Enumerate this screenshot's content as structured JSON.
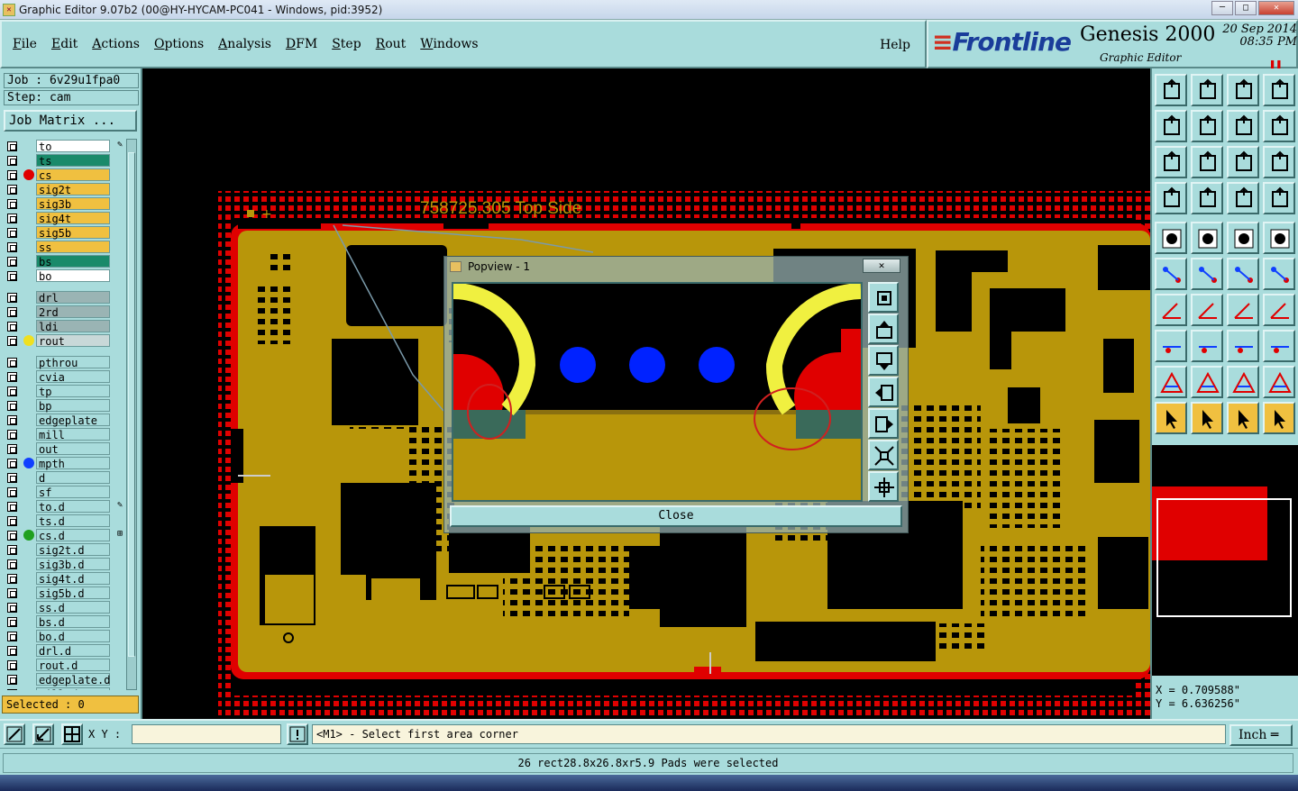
{
  "window": {
    "title": "Graphic Editor 9.07b2 (00@HY-HYCAM-PC041 - Windows, pid:3952)",
    "buttons": {
      "minimize": "─",
      "maximize": "□",
      "close": "✕"
    }
  },
  "menu": {
    "items": [
      "File",
      "Edit",
      "Actions",
      "Options",
      "Analysis",
      "DFM",
      "Step",
      "Rout",
      "Windows"
    ],
    "help": "Help"
  },
  "branding": {
    "logo": "Frontline",
    "product": "Genesis 2000",
    "subtitle": "Graphic Editor",
    "date": "20 Sep 2014",
    "time": "08:35 PM"
  },
  "job": {
    "job_label": "Job : 6v29u1fpa0",
    "step_label": "Step: cam",
    "matrix_button": "Job Matrix ..."
  },
  "layers": {
    "group1": [
      {
        "name": "to",
        "bg": "#ffffff",
        "dot": "",
        "edit": "✎"
      },
      {
        "name": "ts",
        "bg": "#1a8a6a",
        "dot": "",
        "edit": ""
      },
      {
        "name": "cs",
        "bg": "#f0c040",
        "dot": "#e00000",
        "edit": ""
      },
      {
        "name": "sig2t",
        "bg": "#f0c040",
        "dot": "",
        "edit": ""
      },
      {
        "name": "sig3b",
        "bg": "#f0c040",
        "dot": "",
        "edit": ""
      },
      {
        "name": "sig4t",
        "bg": "#f0c040",
        "dot": "",
        "edit": ""
      },
      {
        "name": "sig5b",
        "bg": "#f0c040",
        "dot": "",
        "edit": ""
      },
      {
        "name": "ss",
        "bg": "#f0c040",
        "dot": "",
        "edit": ""
      },
      {
        "name": "bs",
        "bg": "#1a8a6a",
        "dot": "",
        "edit": ""
      },
      {
        "name": "bo",
        "bg": "#ffffff",
        "dot": "",
        "edit": ""
      }
    ],
    "group2": [
      {
        "name": "drl",
        "bg": "#9ab4b4",
        "dot": "",
        "edit": ""
      },
      {
        "name": "2rd",
        "bg": "#9ab4b4",
        "dot": "",
        "edit": ""
      },
      {
        "name": "ldi",
        "bg": "#9ab4b4",
        "dot": "",
        "edit": ""
      },
      {
        "name": "rout",
        "bg": "#c8d8d8",
        "dot": "#f0e020",
        "edit": ""
      }
    ],
    "group3": [
      {
        "name": "pthrou",
        "bg": "#a9dcdc",
        "dot": "",
        "edit": ""
      },
      {
        "name": "cvia",
        "bg": "#a9dcdc",
        "dot": "",
        "edit": ""
      },
      {
        "name": "tp",
        "bg": "#a9dcdc",
        "dot": "",
        "edit": ""
      },
      {
        "name": "bp",
        "bg": "#a9dcdc",
        "dot": "",
        "edit": ""
      },
      {
        "name": "edgeplate",
        "bg": "#a9dcdc",
        "dot": "",
        "edit": ""
      },
      {
        "name": "mill",
        "bg": "#a9dcdc",
        "dot": "",
        "edit": ""
      },
      {
        "name": "out",
        "bg": "#a9dcdc",
        "dot": "",
        "edit": ""
      },
      {
        "name": "mpth",
        "bg": "#a9dcdc",
        "dot": "#1040ff",
        "edit": ""
      },
      {
        "name": "d",
        "bg": "#a9dcdc",
        "dot": "",
        "edit": ""
      },
      {
        "name": "sf",
        "bg": "#a9dcdc",
        "dot": "",
        "edit": ""
      },
      {
        "name": "to.d",
        "bg": "#a9dcdc",
        "dot": "",
        "edit": "✎"
      },
      {
        "name": "ts.d",
        "bg": "#a9dcdc",
        "dot": "",
        "edit": ""
      },
      {
        "name": "cs.d",
        "bg": "#a9dcdc",
        "dot": "#20a020",
        "edit": "⊞"
      },
      {
        "name": "sig2t.d",
        "bg": "#a9dcdc",
        "dot": "",
        "edit": ""
      },
      {
        "name": "sig3b.d",
        "bg": "#a9dcdc",
        "dot": "",
        "edit": ""
      },
      {
        "name": "sig4t.d",
        "bg": "#a9dcdc",
        "dot": "",
        "edit": ""
      },
      {
        "name": "sig5b.d",
        "bg": "#a9dcdc",
        "dot": "",
        "edit": ""
      },
      {
        "name": "ss.d",
        "bg": "#a9dcdc",
        "dot": "",
        "edit": ""
      },
      {
        "name": "bs.d",
        "bg": "#a9dcdc",
        "dot": "",
        "edit": ""
      },
      {
        "name": "bo.d",
        "bg": "#a9dcdc",
        "dot": "",
        "edit": ""
      },
      {
        "name": "drl.d",
        "bg": "#a9dcdc",
        "dot": "",
        "edit": ""
      },
      {
        "name": "rout.d",
        "bg": "#a9dcdc",
        "dot": "",
        "edit": ""
      },
      {
        "name": "edgeplate.d",
        "bg": "#a9dcdc",
        "dot": "",
        "edit": ""
      },
      {
        "name": "mill.d",
        "bg": "#a9dcdc",
        "dot": "",
        "edit": ""
      }
    ],
    "selected": "Selected : 0"
  },
  "board": {
    "label": "758725.305 Top Side",
    "colors": {
      "copper": "#b8960a",
      "mask": "#e00000",
      "feature": "#000000"
    }
  },
  "popview": {
    "title": "Popview - 1",
    "close_x": "✕",
    "close_button": "Close",
    "colors": {
      "trace": "#f0f040",
      "pad": "#e00000",
      "via": "#0022ff",
      "copper": "#b8960a",
      "soldermask": "#3a6a5a"
    }
  },
  "coords": {
    "x": "X = 0.709588\"",
    "y": "Y = 6.636256\""
  },
  "bottom": {
    "xy_label": "X Y :",
    "xy_value": "",
    "hint": "<M1> - Select first area corner",
    "unit": "Inch ═"
  },
  "status": {
    "message": "26 rect28.8x26.8xr5.9 Pads were selected"
  }
}
